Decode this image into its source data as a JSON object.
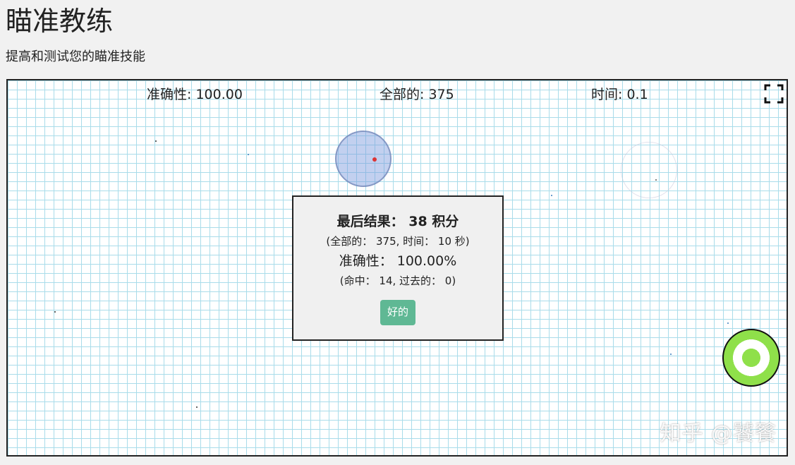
{
  "header": {
    "title": "瞄准教练",
    "subtitle": "提高和测试您的瞄准技能"
  },
  "stats": {
    "accuracy": "准确性: 100.00",
    "total": "全部的: 375",
    "time": "时间: 0.1"
  },
  "result": {
    "title_label": "最后结果：",
    "score": "38 积分",
    "detail": "(全部的： 375, 时间： 10 秒)",
    "accuracy": "准确性： 100.00%",
    "hits": "(命中： 14, 过去的： 0)",
    "ok_label": "好的"
  },
  "watermark": "知乎 @饕餮",
  "icons": {
    "fullscreen": "fullscreen-icon"
  },
  "colors": {
    "grid_line": "#a9dcea",
    "target_blue": "#7896dc",
    "target_green": "#8fe04a",
    "ok_button": "#5fb894"
  }
}
